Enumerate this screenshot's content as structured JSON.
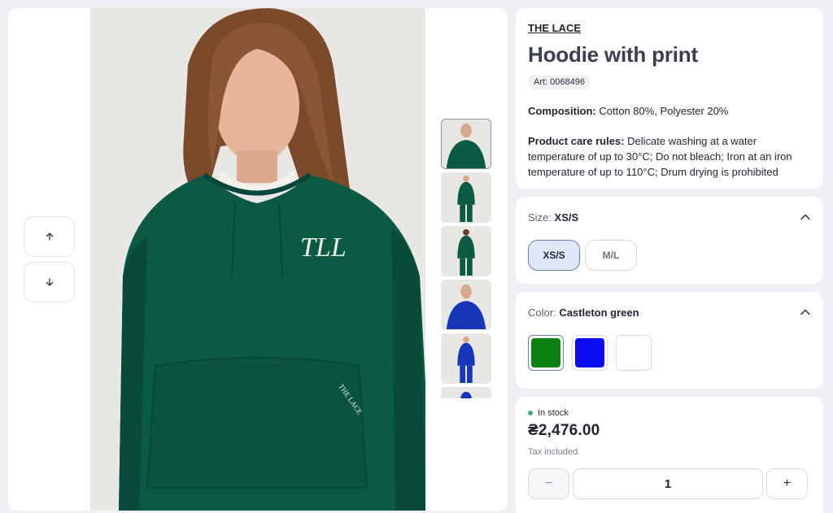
{
  "gallery": {
    "nav_up_icon": "arrow-up-icon",
    "nav_down_icon": "arrow-down-icon",
    "main_photo_logo": "TLL",
    "main_photo_sleeve_text": "THE LACE",
    "thumbnails": [
      {
        "color": "#0b5a43"
      },
      {
        "color": "#0b5a43"
      },
      {
        "color": "#0b5a43"
      },
      {
        "color": "#1737b8"
      },
      {
        "color": "#1737b8"
      },
      {
        "color": "#1737b8"
      }
    ]
  },
  "product": {
    "brand": "THE LACE",
    "title": "Hoodie with print",
    "article": "Art: 0068496",
    "composition_label": "Composition:",
    "composition_value": "Cotton 80%, Polyester 20%",
    "care_label": "Product care rules:",
    "care_value": "Delicate washing at a water temperature of up to 30°C; Do not bleach; Iron at an iron temperature of up to 110°C; Drum drying is prohibited"
  },
  "size": {
    "label": "Size:",
    "selected": "XS/S",
    "options": [
      "XS/S",
      "M/L"
    ]
  },
  "color": {
    "label": "Color:",
    "selected": "Castleton green",
    "swatches": [
      {
        "hex": "#0a8212"
      },
      {
        "hex": "#0c0cf2"
      },
      {
        "hex": "#ffffff"
      }
    ]
  },
  "purchase": {
    "stock": "In stock",
    "price": "₴2,476.00",
    "tax": "Tax included.",
    "quantity": "1",
    "minus_label": "−",
    "plus_label": "+"
  },
  "colors": {
    "accent_selected": "#dfe8f8",
    "stock_dot": "#3bb07a",
    "hoodie_green": "#0b5a43"
  }
}
